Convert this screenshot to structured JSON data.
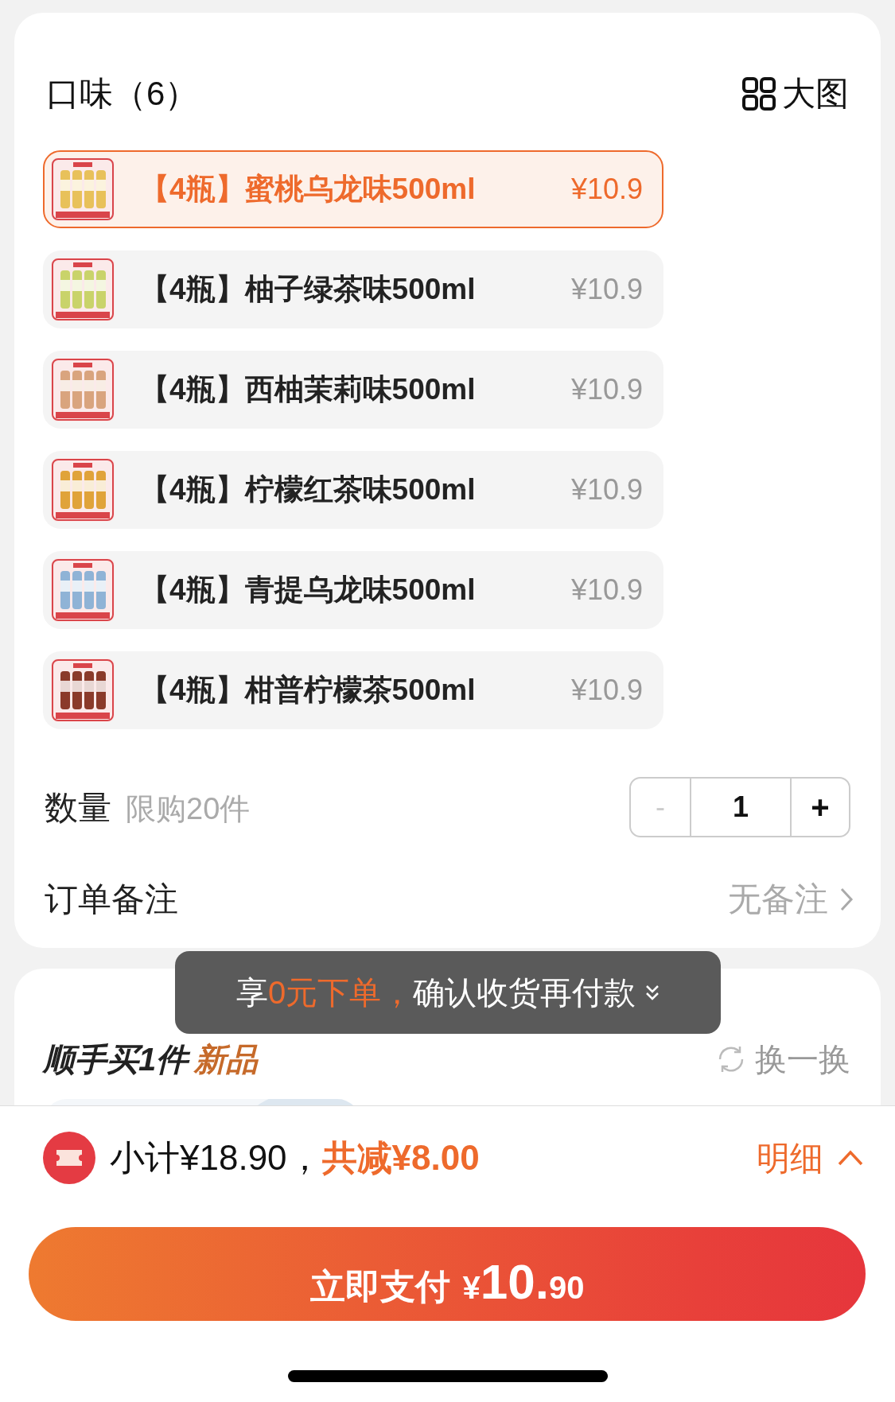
{
  "flavor_section": {
    "title": "口味（6）",
    "view_toggle": "大图",
    "options": [
      {
        "label": "【4瓶】蜜桃乌龙味500ml",
        "price": "¥10.9",
        "selected": true
      },
      {
        "label": "【4瓶】柚子绿茶味500ml",
        "price": "¥10.9",
        "selected": false
      },
      {
        "label": "【4瓶】西柚茉莉味500ml",
        "price": "¥10.9",
        "selected": false
      },
      {
        "label": "【4瓶】柠檬红茶味500ml",
        "price": "¥10.9",
        "selected": false
      },
      {
        "label": "【4瓶】青提乌龙味500ml",
        "price": "¥10.9",
        "selected": false
      },
      {
        "label": "【4瓶】柑普柠檬茶500ml",
        "price": "¥10.9",
        "selected": false
      }
    ]
  },
  "quantity": {
    "label": "数量",
    "limit": "限购20件",
    "minus": "-",
    "value": "1",
    "plus": "+",
    "minus_disabled": true
  },
  "order_note": {
    "label": "订单备注",
    "value": "无备注"
  },
  "recommend": {
    "title": "顺手买1件",
    "tag": "新品",
    "refresh": "换一换"
  },
  "toast": {
    "text": "享**0元下单，**确认收货再付款"
  },
  "summary": {
    "subtotal": "小计¥18.90，",
    "discount": "共减¥8.00",
    "details": "明细"
  },
  "pay_button": {
    "label": "立即支付",
    "currency": "¥",
    "integer": "10.",
    "decimal": "90"
  }
}
